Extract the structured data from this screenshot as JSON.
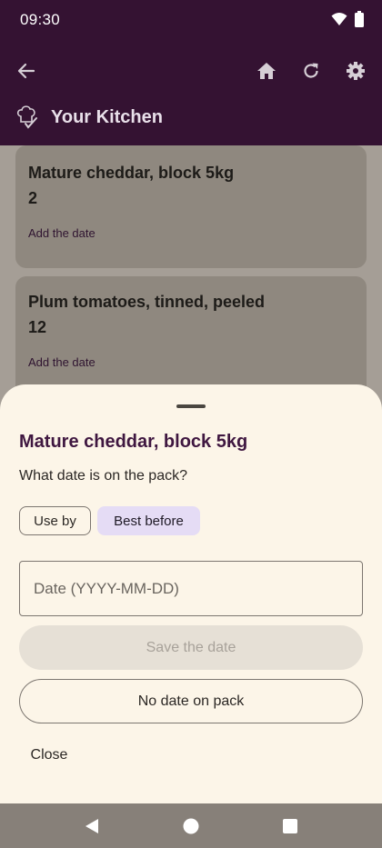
{
  "status": {
    "time": "09:30"
  },
  "app_bar": {
    "title": "Your Kitchen"
  },
  "items": [
    {
      "name": "Mature cheddar, block 5kg",
      "quantity": "2",
      "action": "Add the date"
    },
    {
      "name": "Plum tomatoes, tinned, peeled",
      "quantity": "12",
      "action": "Add the date"
    }
  ],
  "sheet": {
    "title": "Mature cheddar, block 5kg",
    "question": "What date is on the pack?",
    "chip_use_by": "Use by",
    "chip_best_before": "Best before",
    "selected_chip": "Best before",
    "date_placeholder": "Date (YYYY-MM-DD)",
    "date_value": "",
    "save_label": "Save the date",
    "no_date_label": "No date on pack",
    "close_label": "Close"
  },
  "colors": {
    "app_bar": "#341232",
    "sheet_bg": "#fcf5e8",
    "accent_title": "#3f1740",
    "selected_chip_bg": "#e5dcf5"
  },
  "icons": [
    "back-arrow-icon",
    "home-icon",
    "refresh-icon",
    "gear-icon",
    "chef-hat-check-icon",
    "wifi-icon",
    "battery-icon",
    "nav-back-icon",
    "nav-home-icon",
    "nav-recents-icon"
  ]
}
